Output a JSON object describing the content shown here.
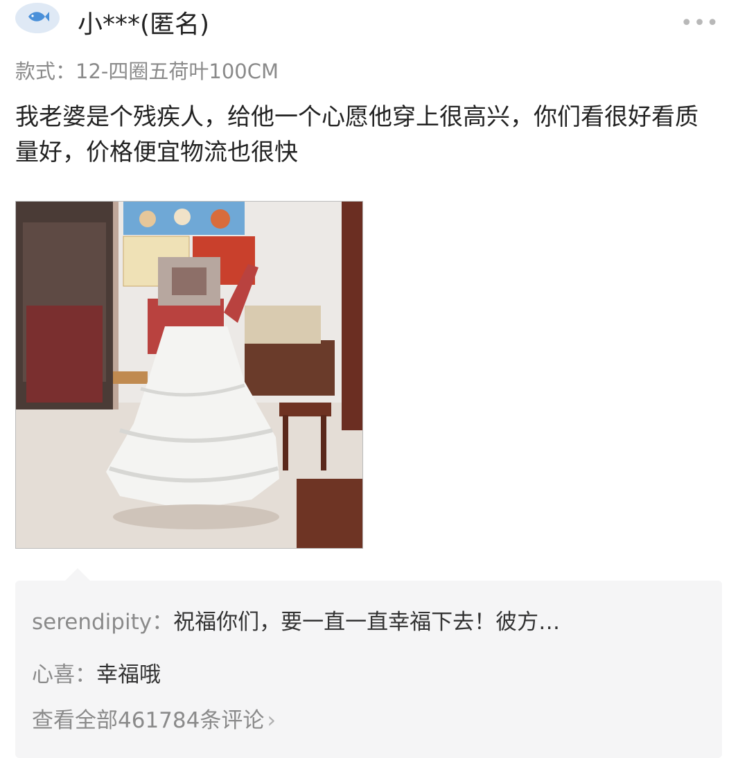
{
  "review": {
    "username": "小***(匿名)",
    "spec": "款式：12-四圈五荷叶100CM",
    "text": "我老婆是个残疾人，给他一个心愿他穿上很高兴，你们看很好看质量好，价格便宜物流也很快",
    "more_icon": "more-dots-icon",
    "avatar_icon": "fish-icon"
  },
  "comments": [
    {
      "author": "serendipity：",
      "text": "祝福你们，要一直一直幸福下去！彼方…"
    },
    {
      "author": "心喜：",
      "text": "幸福哦"
    }
  ],
  "view_all": "查看全部461784条评论",
  "colors": {
    "accent": "#4a90d9",
    "comment_bg": "#f5f5f6",
    "muted": "#8a8a8a"
  }
}
